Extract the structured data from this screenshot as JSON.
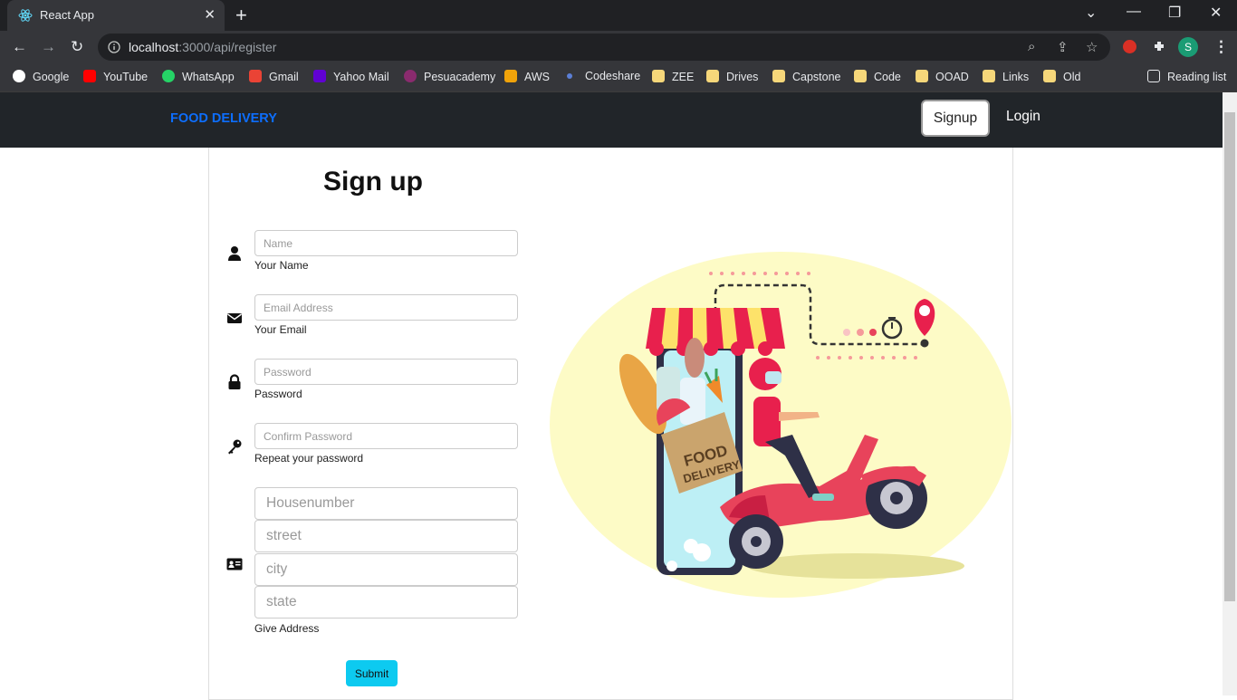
{
  "browser": {
    "tab_title": "React App",
    "url_host": "localhost",
    "url_rest": ":3000/api/register",
    "profile_initial": "S",
    "bookmarks": [
      "Google",
      "YouTube",
      "WhatsApp",
      "Gmail",
      "Yahoo Mail",
      "Pesuacademy",
      "AWS",
      "Codeshare",
      "ZEE",
      "Drives",
      "Capstone",
      "Code",
      "OOAD",
      "Links",
      "Old"
    ],
    "reading_list": "Reading list"
  },
  "navbar": {
    "brand": "FOOD DELIVERY",
    "signup": "Signup",
    "login": "Login"
  },
  "form": {
    "title": "Sign up",
    "name": {
      "placeholder": "Name",
      "help": "Your Name"
    },
    "email": {
      "placeholder": "Email Address",
      "help": "Your Email"
    },
    "password": {
      "placeholder": "Password",
      "help": "Password"
    },
    "confirm": {
      "placeholder": "Confirm Password",
      "help": "Repeat your password"
    },
    "address": {
      "housenumber": "Housenumber",
      "street": "street",
      "city": "city",
      "state": "state",
      "help": "Give Address"
    },
    "submit": "Submit"
  },
  "illustration": {
    "bag_text_1": "FOOD",
    "bag_text_2": "DELIVERY"
  },
  "colors": {
    "brand": "#0d6efd",
    "submit": "#0dcaf0",
    "navbar": "#212529"
  }
}
